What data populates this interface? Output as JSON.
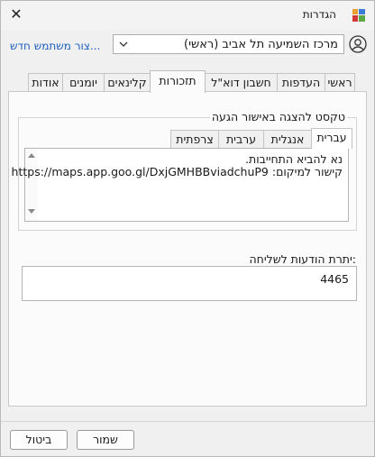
{
  "window": {
    "title": "הגדרות",
    "close_symbol": "✕"
  },
  "user": {
    "selected": "מרכז השמיעה תל אביב (ראשי)",
    "new_user_link": "צור משתמש חדש..."
  },
  "tabs": [
    "ראשי",
    "העדפות",
    "חשבון דוא\"ל",
    "תזכורות",
    "קלינאים",
    "יומנים",
    "אודות"
  ],
  "active_tab": "תזכורות",
  "reminders": {
    "group_title": "טקסט להצגה באישור הגעה",
    "language_tabs": [
      "עברית",
      "אנגלית",
      "ערבית",
      "צרפתית"
    ],
    "active_language": "עברית",
    "message_lines": [
      "נא להביא התחייבות.",
      "קישור למיקום: https://maps.app.goo.gl/DxjGMHBBviadchuP9"
    ],
    "remaining_label": "יתרת הודעות לשליחה:",
    "remaining_value": "4465"
  },
  "footer": {
    "save_label": "שמור",
    "cancel_label": "ביטול"
  },
  "colors": {
    "link": "#1f5fbf",
    "background": "#f0f0f0"
  },
  "icons": {
    "app": "settings-app-icon",
    "user": "user-avatar-icon",
    "close": "close-icon",
    "dropdown": "chevron-down-icon"
  }
}
